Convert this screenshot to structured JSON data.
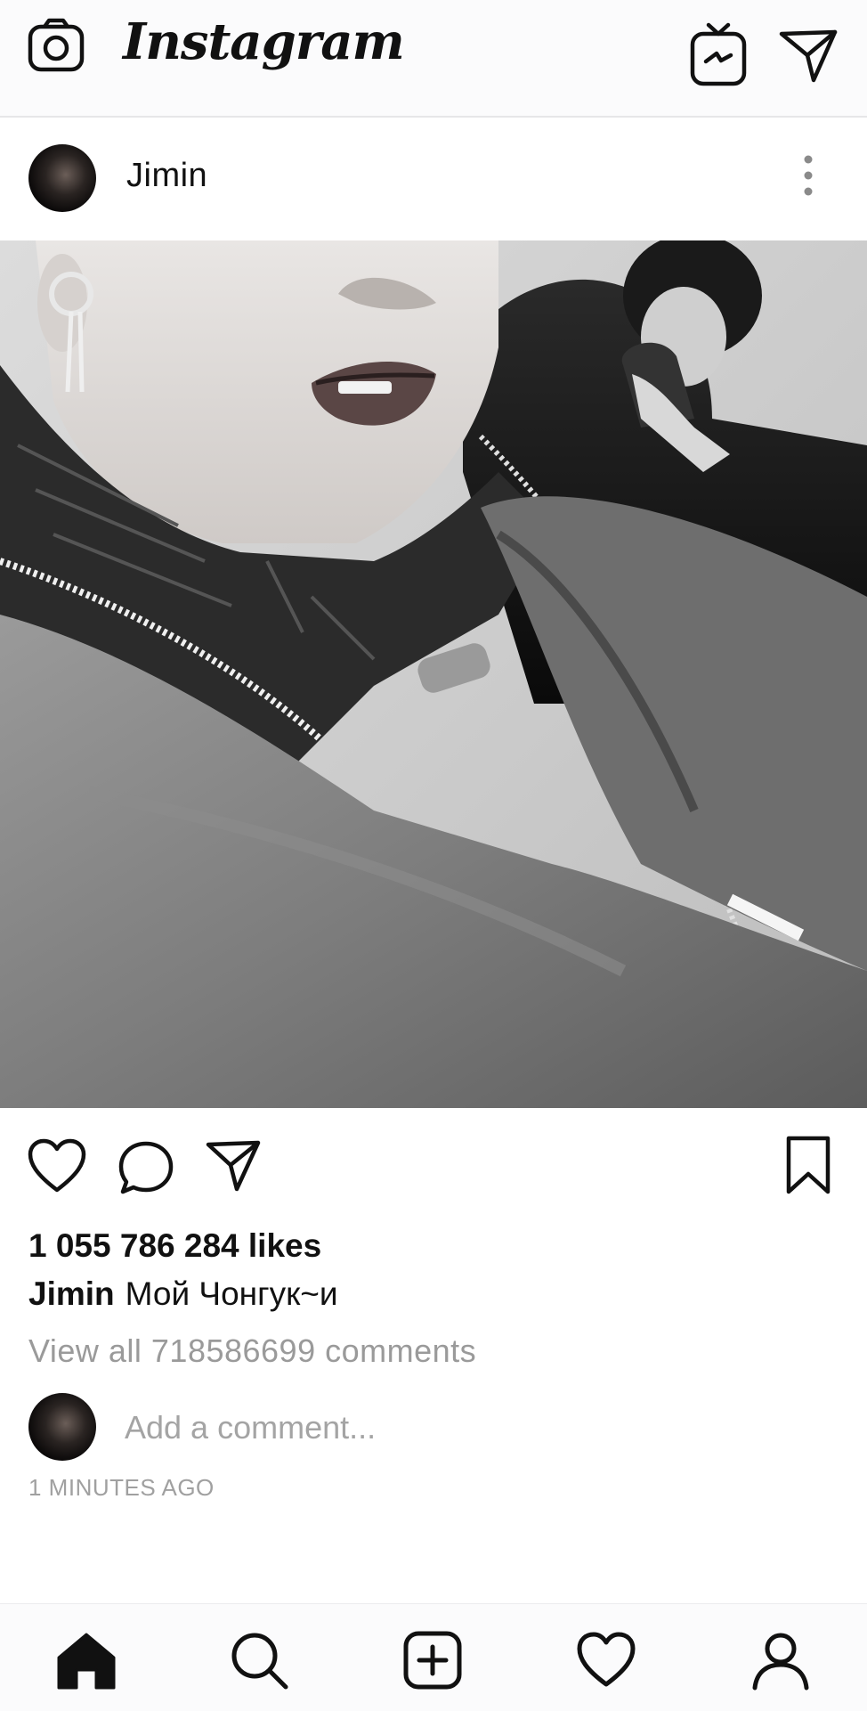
{
  "header": {
    "app_title": "Instagram"
  },
  "post": {
    "username": "Jimin",
    "likes": "1 055 786 284 likes",
    "caption_user": "Jimin",
    "caption_text": "Мой Чонгук~и",
    "view_comments": "View all 718586699 comments",
    "comment_placeholder": "Add a comment...",
    "timestamp": "1 MINUTES AGO"
  },
  "nav": {
    "items": [
      "home",
      "search",
      "new-post",
      "activity",
      "profile"
    ],
    "active": "home"
  },
  "icons": {
    "top_left": "camera-icon",
    "top_right": [
      "igtv-icon",
      "direct-message-icon"
    ],
    "post_actions": [
      "heart-icon",
      "comment-icon",
      "share-icon",
      "bookmark-icon"
    ],
    "more": "more-options-icon"
  },
  "colors": {
    "topbar_bg": "#fbfbfc",
    "text": "#111111",
    "muted": "#9a9a9a"
  }
}
